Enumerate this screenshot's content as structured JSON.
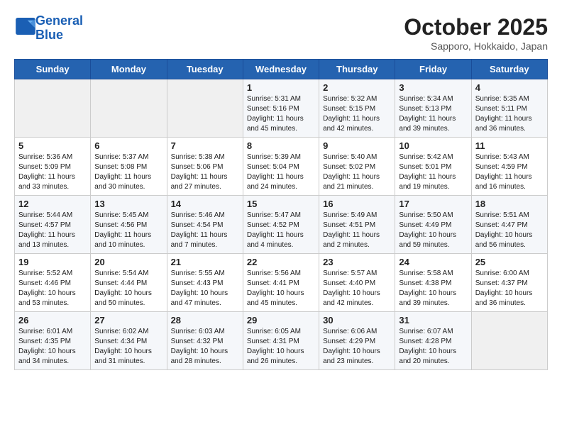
{
  "header": {
    "logo_line1": "General",
    "logo_line2": "Blue",
    "month": "October 2025",
    "location": "Sapporo, Hokkaido, Japan"
  },
  "weekdays": [
    "Sunday",
    "Monday",
    "Tuesday",
    "Wednesday",
    "Thursday",
    "Friday",
    "Saturday"
  ],
  "weeks": [
    [
      {
        "day": "",
        "info": ""
      },
      {
        "day": "",
        "info": ""
      },
      {
        "day": "",
        "info": ""
      },
      {
        "day": "1",
        "info": "Sunrise: 5:31 AM\nSunset: 5:16 PM\nDaylight: 11 hours and 45 minutes."
      },
      {
        "day": "2",
        "info": "Sunrise: 5:32 AM\nSunset: 5:15 PM\nDaylight: 11 hours and 42 minutes."
      },
      {
        "day": "3",
        "info": "Sunrise: 5:34 AM\nSunset: 5:13 PM\nDaylight: 11 hours and 39 minutes."
      },
      {
        "day": "4",
        "info": "Sunrise: 5:35 AM\nSunset: 5:11 PM\nDaylight: 11 hours and 36 minutes."
      }
    ],
    [
      {
        "day": "5",
        "info": "Sunrise: 5:36 AM\nSunset: 5:09 PM\nDaylight: 11 hours and 33 minutes."
      },
      {
        "day": "6",
        "info": "Sunrise: 5:37 AM\nSunset: 5:08 PM\nDaylight: 11 hours and 30 minutes."
      },
      {
        "day": "7",
        "info": "Sunrise: 5:38 AM\nSunset: 5:06 PM\nDaylight: 11 hours and 27 minutes."
      },
      {
        "day": "8",
        "info": "Sunrise: 5:39 AM\nSunset: 5:04 PM\nDaylight: 11 hours and 24 minutes."
      },
      {
        "day": "9",
        "info": "Sunrise: 5:40 AM\nSunset: 5:02 PM\nDaylight: 11 hours and 21 minutes."
      },
      {
        "day": "10",
        "info": "Sunrise: 5:42 AM\nSunset: 5:01 PM\nDaylight: 11 hours and 19 minutes."
      },
      {
        "day": "11",
        "info": "Sunrise: 5:43 AM\nSunset: 4:59 PM\nDaylight: 11 hours and 16 minutes."
      }
    ],
    [
      {
        "day": "12",
        "info": "Sunrise: 5:44 AM\nSunset: 4:57 PM\nDaylight: 11 hours and 13 minutes."
      },
      {
        "day": "13",
        "info": "Sunrise: 5:45 AM\nSunset: 4:56 PM\nDaylight: 11 hours and 10 minutes."
      },
      {
        "day": "14",
        "info": "Sunrise: 5:46 AM\nSunset: 4:54 PM\nDaylight: 11 hours and 7 minutes."
      },
      {
        "day": "15",
        "info": "Sunrise: 5:47 AM\nSunset: 4:52 PM\nDaylight: 11 hours and 4 minutes."
      },
      {
        "day": "16",
        "info": "Sunrise: 5:49 AM\nSunset: 4:51 PM\nDaylight: 11 hours and 2 minutes."
      },
      {
        "day": "17",
        "info": "Sunrise: 5:50 AM\nSunset: 4:49 PM\nDaylight: 10 hours and 59 minutes."
      },
      {
        "day": "18",
        "info": "Sunrise: 5:51 AM\nSunset: 4:47 PM\nDaylight: 10 hours and 56 minutes."
      }
    ],
    [
      {
        "day": "19",
        "info": "Sunrise: 5:52 AM\nSunset: 4:46 PM\nDaylight: 10 hours and 53 minutes."
      },
      {
        "day": "20",
        "info": "Sunrise: 5:54 AM\nSunset: 4:44 PM\nDaylight: 10 hours and 50 minutes."
      },
      {
        "day": "21",
        "info": "Sunrise: 5:55 AM\nSunset: 4:43 PM\nDaylight: 10 hours and 47 minutes."
      },
      {
        "day": "22",
        "info": "Sunrise: 5:56 AM\nSunset: 4:41 PM\nDaylight: 10 hours and 45 minutes."
      },
      {
        "day": "23",
        "info": "Sunrise: 5:57 AM\nSunset: 4:40 PM\nDaylight: 10 hours and 42 minutes."
      },
      {
        "day": "24",
        "info": "Sunrise: 5:58 AM\nSunset: 4:38 PM\nDaylight: 10 hours and 39 minutes."
      },
      {
        "day": "25",
        "info": "Sunrise: 6:00 AM\nSunset: 4:37 PM\nDaylight: 10 hours and 36 minutes."
      }
    ],
    [
      {
        "day": "26",
        "info": "Sunrise: 6:01 AM\nSunset: 4:35 PM\nDaylight: 10 hours and 34 minutes."
      },
      {
        "day": "27",
        "info": "Sunrise: 6:02 AM\nSunset: 4:34 PM\nDaylight: 10 hours and 31 minutes."
      },
      {
        "day": "28",
        "info": "Sunrise: 6:03 AM\nSunset: 4:32 PM\nDaylight: 10 hours and 28 minutes."
      },
      {
        "day": "29",
        "info": "Sunrise: 6:05 AM\nSunset: 4:31 PM\nDaylight: 10 hours and 26 minutes."
      },
      {
        "day": "30",
        "info": "Sunrise: 6:06 AM\nSunset: 4:29 PM\nDaylight: 10 hours and 23 minutes."
      },
      {
        "day": "31",
        "info": "Sunrise: 6:07 AM\nSunset: 4:28 PM\nDaylight: 10 hours and 20 minutes."
      },
      {
        "day": "",
        "info": ""
      }
    ]
  ]
}
